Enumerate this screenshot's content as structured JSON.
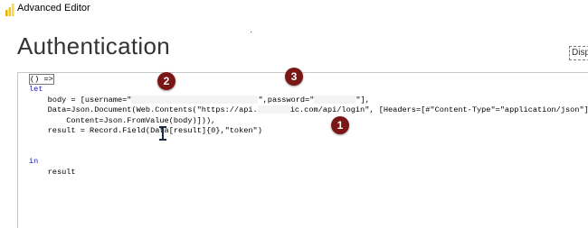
{
  "window": {
    "title": "Advanced Editor"
  },
  "page": {
    "title": "Authentication",
    "display_button": "Displ"
  },
  "code": {
    "line1": "() =>",
    "line2": "let",
    "line3_a": "    body = [username=\"",
    "line3_b": "\",password=\"",
    "line3_c": "\"],",
    "line4_a": "    Data=Json.Document(Web.Contents(\"https://api.",
    "line4_b": "ic.com/api/login\", [Headers=[#\"Content-Type\"=\"application/json\"],",
    "line5": "        Content=Json.FromValue(body)])),",
    "line6_a": "    result = Record.Field(Data",
    "line6_b": "[result]{0},\"token\")",
    "line7": "in",
    "line8": "    result"
  },
  "annotations": [
    "2",
    "3",
    "1"
  ],
  "colors": {
    "badge": "#7a1616",
    "keyword": "#1a1aa6",
    "string": "#a31515"
  }
}
